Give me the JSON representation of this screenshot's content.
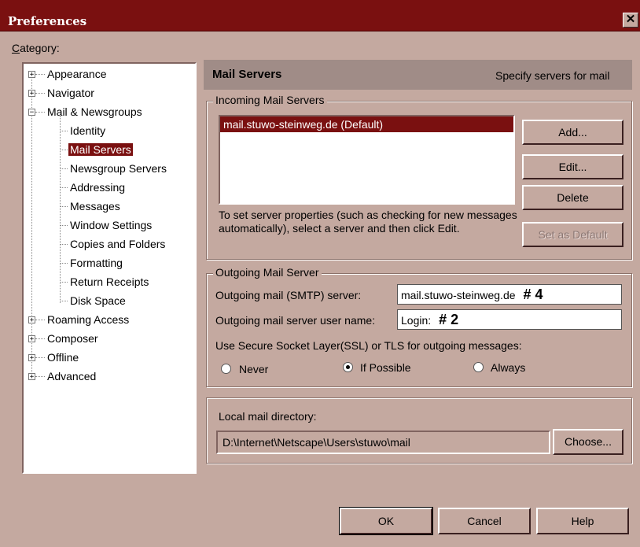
{
  "window": {
    "title": "Preferences",
    "close_glyph": "✕"
  },
  "category_label": "Category:",
  "tree": {
    "items": [
      {
        "label": "Appearance",
        "expander": "+"
      },
      {
        "label": "Navigator",
        "expander": "+"
      },
      {
        "label": "Mail & Newsgroups",
        "expander": "−"
      },
      {
        "label": "Identity"
      },
      {
        "label": "Mail Servers"
      },
      {
        "label": "Newsgroup Servers"
      },
      {
        "label": "Addressing"
      },
      {
        "label": "Messages"
      },
      {
        "label": "Window Settings"
      },
      {
        "label": "Copies and Folders"
      },
      {
        "label": "Formatting"
      },
      {
        "label": "Return Receipts"
      },
      {
        "label": "Disk Space"
      },
      {
        "label": "Roaming Access",
        "expander": "+"
      },
      {
        "label": "Composer",
        "expander": "+"
      },
      {
        "label": "Offline",
        "expander": "+"
      },
      {
        "label": "Advanced",
        "expander": "+"
      }
    ]
  },
  "header": {
    "title": "Mail Servers",
    "subtitle": "Specify servers for mail"
  },
  "incoming": {
    "legend": "Incoming Mail Servers",
    "servers": [
      "mail.stuwo-steinweg.de (Default)"
    ],
    "help_text": "To set server properties (such as checking for new messages automatically), select a server and then click Edit.",
    "buttons": {
      "add": "Add...",
      "edit": "Edit...",
      "delete": "Delete",
      "set_default": "Set as Default"
    }
  },
  "outgoing": {
    "legend": "Outgoing Mail Server",
    "smtp_label": "Outgoing mail (SMTP) server:",
    "smtp_value": "mail.stuwo-steinweg.de",
    "smtp_note": "# 4",
    "user_label": "Outgoing mail server user name:",
    "user_value": "Login:",
    "user_note": "# 2",
    "ssl_label": "Use Secure Socket Layer(SSL) or TLS for outgoing messages:",
    "ssl_options": {
      "never": "Never",
      "if_possible": "If Possible",
      "always": "Always"
    },
    "ssl_selected": "If Possible"
  },
  "local": {
    "label": "Local mail directory:",
    "path": "D:\\Internet\\Netscape\\Users\\stuwo\\mail",
    "choose": "Choose..."
  },
  "footer": {
    "ok": "OK",
    "cancel": "Cancel",
    "help": "Help"
  },
  "colors": {
    "title_bar": "#7a1010",
    "dialog_bg": "#c4a9a0",
    "header_bg": "#a08c87",
    "selection": "#7a1010"
  }
}
